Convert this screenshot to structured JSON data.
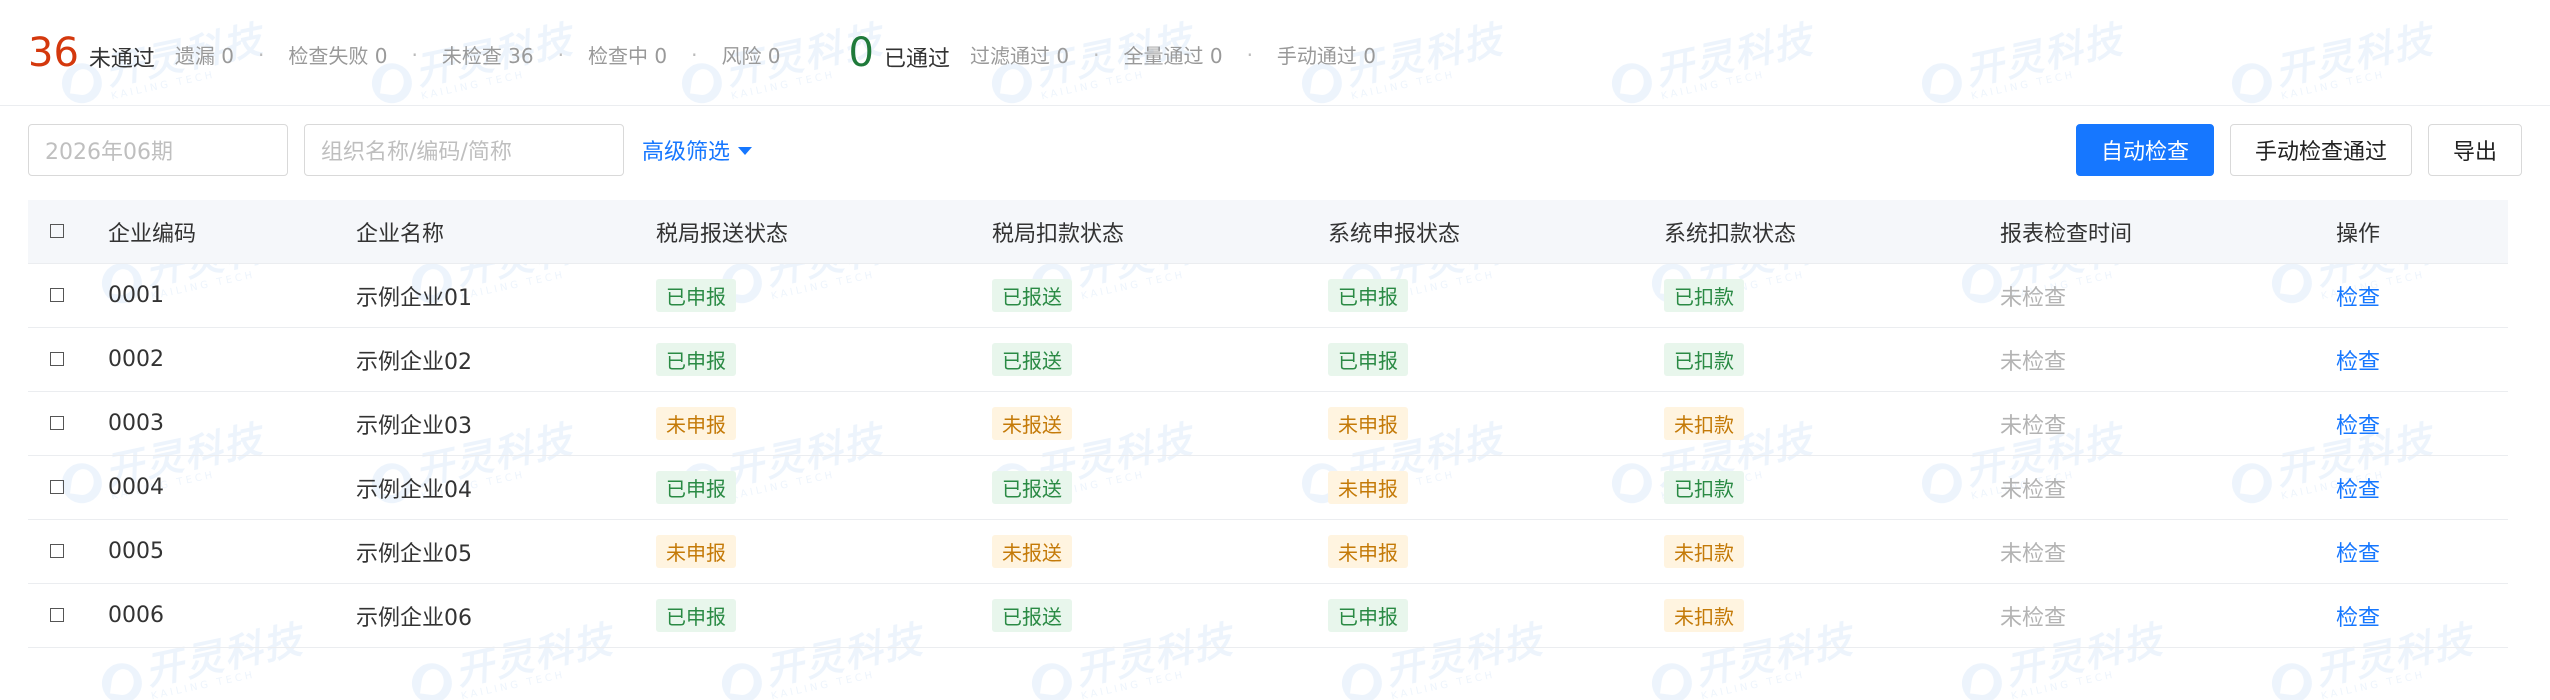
{
  "summary": {
    "fail_count": "36",
    "fail_label": "未通过",
    "fail_items": [
      "遗漏 0",
      "检查失败 0",
      "未检查 36",
      "检查中 0",
      "风险 0"
    ],
    "pass_count": "0",
    "pass_label": "已通过",
    "pass_items": [
      "过滤通过 0",
      "全量通过 0",
      "手动通过 0"
    ]
  },
  "filters": {
    "period_placeholder": "2026年06期",
    "org_placeholder": "组织名称/编码/简称",
    "advanced_label": "高级筛选"
  },
  "actions": {
    "auto_check": "自动检查",
    "manual_pass": "手动检查通过",
    "export": "导出"
  },
  "table": {
    "columns": [
      "企业编码",
      "企业名称",
      "税局报送状态",
      "税局扣款状态",
      "系统申报状态",
      "系统扣款状态",
      "报表检查时间",
      "操作"
    ],
    "rows": [
      {
        "code": "0001",
        "name": "示例企业01",
        "s1": "已申报",
        "s1_type": "ok",
        "s2": "已报送",
        "s2_type": "ok",
        "s3": "已申报",
        "s3_type": "ok",
        "s4": "已扣款",
        "s4_type": "ok",
        "time": "未检查",
        "op": "检查"
      },
      {
        "code": "0002",
        "name": "示例企业02",
        "s1": "已申报",
        "s1_type": "ok",
        "s2": "已报送",
        "s2_type": "ok",
        "s3": "已申报",
        "s3_type": "ok",
        "s4": "已扣款",
        "s4_type": "ok",
        "time": "未检查",
        "op": "检查"
      },
      {
        "code": "0003",
        "name": "示例企业03",
        "s1": "未申报",
        "s1_type": "warn",
        "s2": "未报送",
        "s2_type": "warn",
        "s3": "未申报",
        "s3_type": "warn",
        "s4": "未扣款",
        "s4_type": "warn",
        "time": "未检查",
        "op": "检查"
      },
      {
        "code": "0004",
        "name": "示例企业04",
        "s1": "已申报",
        "s1_type": "ok",
        "s2": "已报送",
        "s2_type": "ok",
        "s3": "未申报",
        "s3_type": "warn",
        "s4": "已扣款",
        "s4_type": "ok",
        "time": "未检查",
        "op": "检查"
      },
      {
        "code": "0005",
        "name": "示例企业05",
        "s1": "未申报",
        "s1_type": "warn",
        "s2": "未报送",
        "s2_type": "warn",
        "s3": "未申报",
        "s3_type": "warn",
        "s4": "未扣款",
        "s4_type": "warn",
        "time": "未检查",
        "op": "检查"
      },
      {
        "code": "0006",
        "name": "示例企业06",
        "s1": "已申报",
        "s1_type": "ok",
        "s2": "已报送",
        "s2_type": "ok",
        "s3": "已申报",
        "s3_type": "ok",
        "s4": "未扣款",
        "s4_type": "warn",
        "time": "未检查",
        "op": "检查"
      }
    ]
  },
  "watermark": {
    "title": "开灵科技",
    "subtitle": "KAILING TECH"
  },
  "colors": {
    "fail": "#d4380d",
    "pass": "#1f7a3a",
    "primary": "#1677ff",
    "tag_ok_bg": "#e8f6ec",
    "tag_warn_bg": "#fff4e0"
  }
}
